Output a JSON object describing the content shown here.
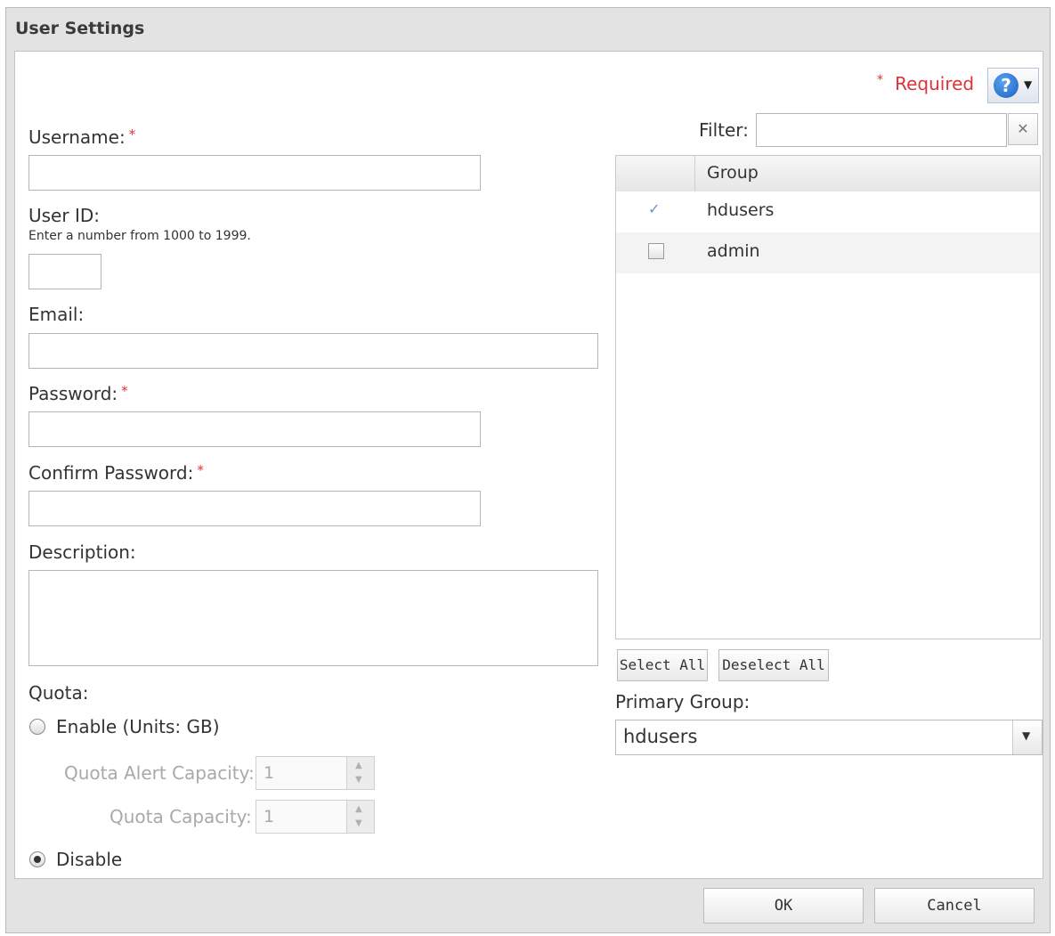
{
  "window": {
    "title": "User Settings"
  },
  "required_note": "Required",
  "required_mark": "*",
  "fields": {
    "username_label": "Username:",
    "userid_label": "User ID:",
    "userid_hint": "Enter a number from 1000 to 1999.",
    "email_label": "Email:",
    "password_label": "Password:",
    "confirm_password_label": "Confirm Password:",
    "description_label": "Description:"
  },
  "quota": {
    "label": "Quota:",
    "enable_label": "Enable (Units: GB)",
    "alert_label": "Quota Alert Capacity:",
    "alert_value": "1",
    "capacity_label": "Quota Capacity:",
    "capacity_value": "1",
    "disable_label": "Disable",
    "selected": "Disable"
  },
  "filter": {
    "label": "Filter:",
    "value": ""
  },
  "groups": {
    "column_header": "Group",
    "rows": [
      {
        "name": "hdusers",
        "checked": true
      },
      {
        "name": "admin",
        "checked": false
      }
    ],
    "select_all": "Select All",
    "deselect_all": "Deselect All"
  },
  "primary_group": {
    "label": "Primary Group:",
    "value": "hdusers"
  },
  "footer": {
    "ok": "OK",
    "cancel": "Cancel"
  },
  "icons": {
    "help": "help-icon",
    "clear": "close-icon",
    "dropdown": "chevron-down-icon"
  },
  "colors": {
    "required": "#e0303a",
    "help_blue": "#1c5fc0"
  }
}
